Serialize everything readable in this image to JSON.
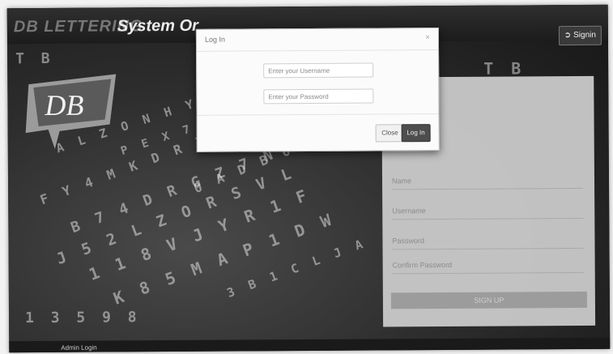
{
  "app": {
    "brand_left": "DB LETTERING",
    "brand_right": "System Or",
    "logo_text": "DB",
    "signin_label": "Signin"
  },
  "background_letters": [
    "T B",
    "A L Z O N H Y L",
    "P E X 7 R H A B",
    "F Y 4 M K D R 7 Z N",
    "0 A D B 6 Z 7 N 0 N",
    "B 7 4 D R G Z 7 N",
    "J 5 2 L Z O R S V L",
    "1 1 8 V J Y R 1 F",
    "K 8 5 M A P 1 D W",
    "3 B 1 C L J A",
    "T B",
    "1 3 5 9 8"
  ],
  "login_modal": {
    "title": "Log In",
    "close_icon": "×",
    "username_placeholder": "Enter your Username",
    "password_placeholder": "Enter your Password",
    "close_button": "Close",
    "login_button": "Log In"
  },
  "register_panel": {
    "fields": [
      "Name",
      "Username",
      "Password",
      "Confirm Password"
    ],
    "submit_label": "SIGN UP"
  },
  "footer": {
    "admin_link": "Admin Login"
  },
  "colors": {
    "panel": "#cdcdcd",
    "login_button": "#4d4d4d",
    "topbar": "#1c1c1c"
  }
}
